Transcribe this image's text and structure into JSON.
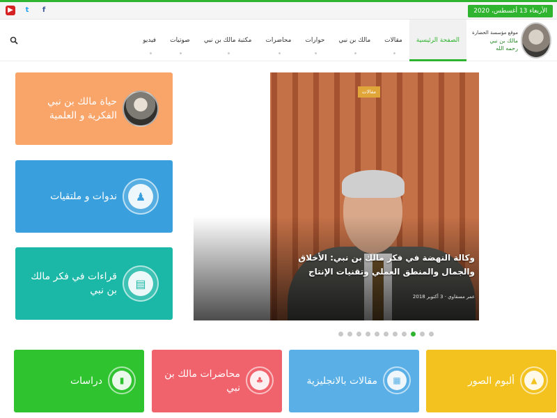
{
  "topbar": {
    "date": "الأربعاء 13 أغسطس، 2020",
    "social": {
      "facebook": "f",
      "twitter": "t",
      "youtube": "▶"
    }
  },
  "logo": {
    "line1": "موقع مؤسسة الحضارة",
    "line2": "مالك بن نبي",
    "line3": "رحمه الله"
  },
  "nav": {
    "items": [
      {
        "label": "الصفحة الرئيسية",
        "active": true
      },
      {
        "label": "مقالات"
      },
      {
        "label": "مالك بن نبي"
      },
      {
        "label": "حوارات"
      },
      {
        "label": "محاضرات"
      },
      {
        "label": "مكتبة مالك بن نبي"
      },
      {
        "label": "صوتيات"
      },
      {
        "label": "فيديو"
      }
    ]
  },
  "slider": {
    "category": "مقالات",
    "title": "وكالة النهضة في فكر مالك بن نبي: الأخلاق والجمال والمنطق العملي وتقنيات الإنتاج",
    "meta": "عمر مسقاوي · 3 أكتوبر 2018"
  },
  "side_cards": [
    {
      "label": "حياة مالك بن نبي الفكرية و العلمية",
      "icon": "portrait-icon"
    },
    {
      "label": "ندوات و ملتقيات",
      "icon": "conference-icon"
    },
    {
      "label": "قراءات في فكر مالك بن نبي",
      "icon": "book-icon"
    }
  ],
  "tiles": [
    {
      "label": "ألبوم الصور",
      "icon": "image-icon"
    },
    {
      "label": "مقالات بالانجليزية",
      "icon": "document-icon"
    },
    {
      "label": "محاضرات مالك بن نبي",
      "icon": "lecture-icon"
    },
    {
      "label": "دراسات",
      "icon": "chart-icon"
    }
  ],
  "colors": {
    "accent": "#2fb42f",
    "orange": "#f9a56a",
    "blue": "#3aa0dd",
    "teal": "#1cb8a7",
    "yellow": "#f3c21f",
    "light_blue": "#5ab0e6",
    "pink": "#f0626c",
    "green": "#2fc42f"
  }
}
